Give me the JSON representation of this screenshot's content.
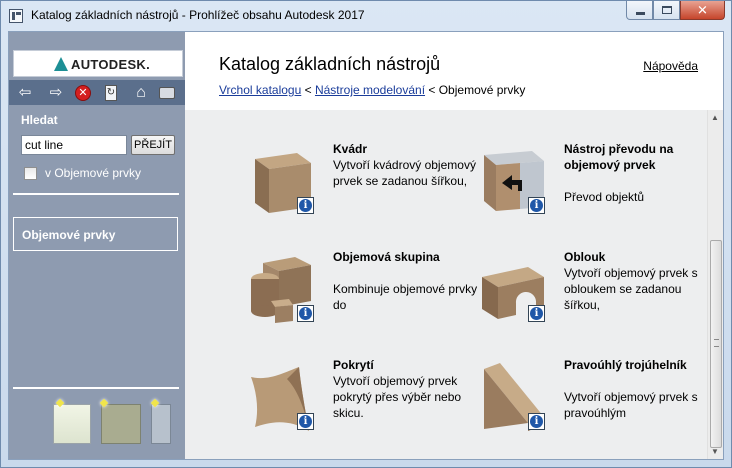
{
  "window": {
    "title": "Katalog základních nástrojů - Prohlížeč obsahu Autodesk 2017",
    "minimize": "minimize",
    "maximize": "maximize",
    "close": "✕"
  },
  "sidebar": {
    "logo": "AUTODESK.",
    "search": {
      "label": "Hledat",
      "value": "cut line",
      "go_button": "PŘEJÍT",
      "scope_label": "v Objemové prvky",
      "scope_checked": false
    },
    "section": "Objemové prvky"
  },
  "header": {
    "title": "Katalog základních nástrojů",
    "help": "Nápověda",
    "breadcrumb": {
      "link1": "Vrchol katalogu",
      "sep1": " < ",
      "link2": "Nástroje modelování",
      "sep2": " < ",
      "current": "Objemové prvky"
    }
  },
  "tools": [
    {
      "title": "Kvádr",
      "description": "Vytvoří kvádrový objemový prvek se zadanou šířkou,"
    },
    {
      "title": "Nástroj převodu na objemový prvek",
      "description": "Převod objektů"
    },
    {
      "title": "Objemová skupina",
      "description": "Kombinuje objemové prvky do"
    },
    {
      "title": "Oblouk",
      "description": "Vytvoří objemový prvek s obloukem se zadanou šířkou,"
    },
    {
      "title": "Pokrytí",
      "description": "Vytvoří objemový prvek pokrytý přes výběr nebo skicu."
    },
    {
      "title": "Pravoúhlý trojúhelník",
      "description": "Vytvoří objemový prvek s pravoúhlým"
    }
  ],
  "colors": {
    "sidebar": "#8e9bb0",
    "navbar": "#5b6f8c",
    "link": "#1a3c9a",
    "thumb_brown": "#a08566"
  },
  "icons": [
    "back-arrow-icon",
    "forward-arrow-icon",
    "stop-icon",
    "refresh-icon",
    "home-icon",
    "print-icon",
    "info-icon"
  ]
}
